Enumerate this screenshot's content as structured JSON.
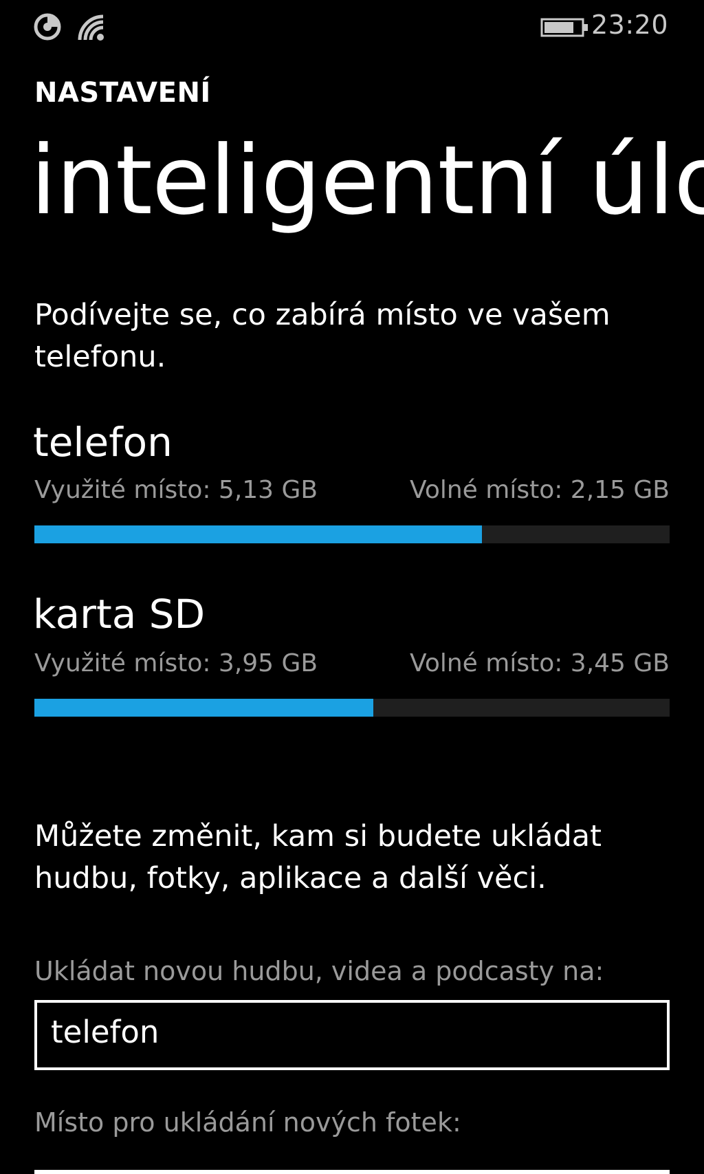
{
  "status_bar": {
    "icons": [
      "notification-icon",
      "wifi-icon",
      "battery-icon"
    ],
    "time": "23:20"
  },
  "header": {
    "section": "NASTAVENÍ",
    "title": "inteligentní úlo"
  },
  "intro_text": "Podívejte se, co zabírá místo ve vašem telefonu.",
  "storage": [
    {
      "label": "telefon",
      "used_text": "Využité místo: 5,13 GB",
      "free_text": "Volné místo: 2,15 GB",
      "used_fraction": 0.7046
    },
    {
      "label": "karta SD",
      "used_text": "Využité místo: 3,95 GB",
      "free_text": "Volné místo: 3,45 GB",
      "used_fraction": 0.5338
    }
  ],
  "change_text": "Můžete změnit, kam si budete ukládat hudbu, fotky, aplikace a další věci.",
  "settings": [
    {
      "label": "Ukládat novou hudbu, videa a podcasty na:",
      "value": "telefon"
    },
    {
      "label": "Místo pro ukládání nových fotek:",
      "value": ""
    }
  ],
  "colors": {
    "accent": "#1ba1e2",
    "background": "#000000",
    "track": "#1f1f1f",
    "secondary_text": "#9a9a9a"
  }
}
